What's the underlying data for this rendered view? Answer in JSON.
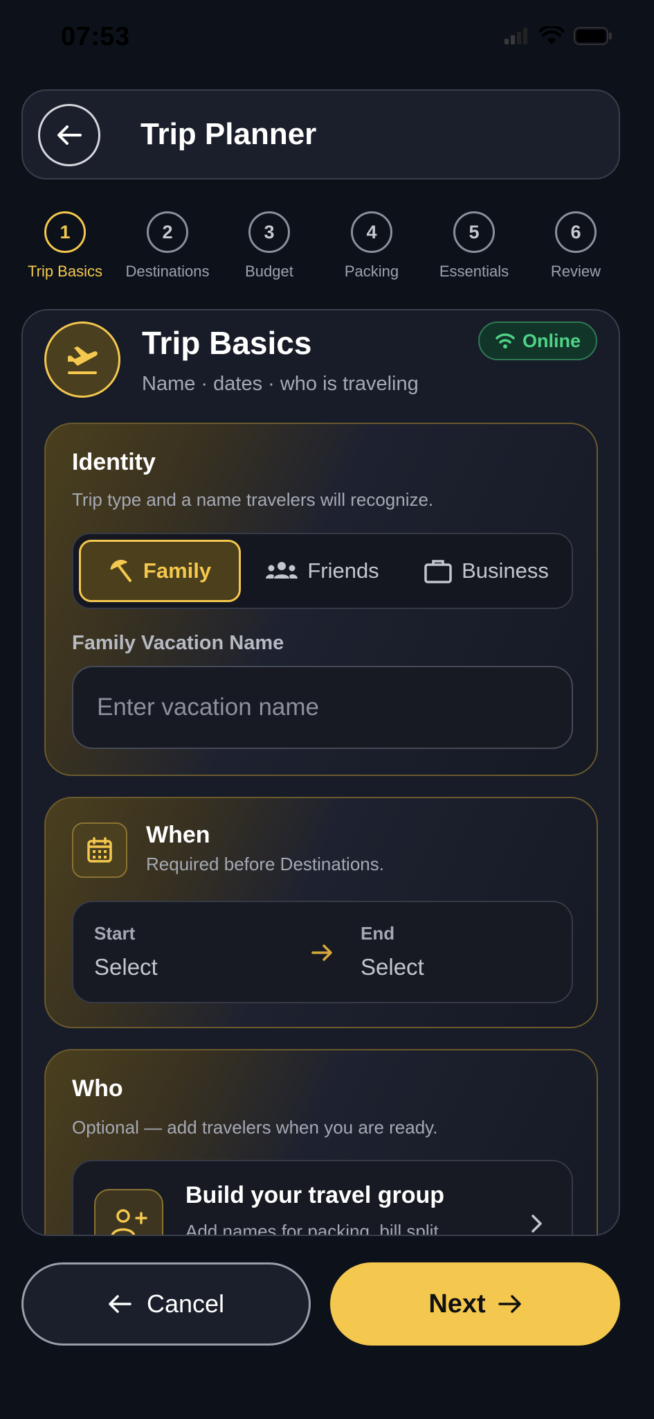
{
  "status_bar": {
    "time": "07:53"
  },
  "header": {
    "title": "Trip Planner"
  },
  "steps": [
    {
      "num": "1",
      "label": "Trip Basics"
    },
    {
      "num": "2",
      "label": "Destinations"
    },
    {
      "num": "3",
      "label": "Budget"
    },
    {
      "num": "4",
      "label": "Packing"
    },
    {
      "num": "5",
      "label": "Essentials"
    },
    {
      "num": "6",
      "label": "Review"
    }
  ],
  "card": {
    "title": "Trip Basics",
    "subtitle": "Name · dates · who is traveling",
    "badge": "Online"
  },
  "identity": {
    "title": "Identity",
    "description": "Trip type and a name travelers will recognize.",
    "options": [
      "Family",
      "Friends",
      "Business"
    ],
    "selected": "Family",
    "field_label": "Family Vacation Name",
    "input_value": "",
    "input_placeholder": "Enter vacation name"
  },
  "when": {
    "title": "When",
    "description": "Required before Destinations.",
    "start_label": "Start",
    "start_value": "Select",
    "end_label": "End",
    "end_value": "Select"
  },
  "who": {
    "title": "Who",
    "description": "Optional — add travelers when you are ready.",
    "group_title": "Build your travel group",
    "group_description": "Add names for packing, bill split,"
  },
  "footer": {
    "cancel_label": "Cancel",
    "next_label": "Next"
  },
  "colors": {
    "accent": "#f4c84e",
    "background": "#0d111a",
    "online": "#4ed486"
  }
}
